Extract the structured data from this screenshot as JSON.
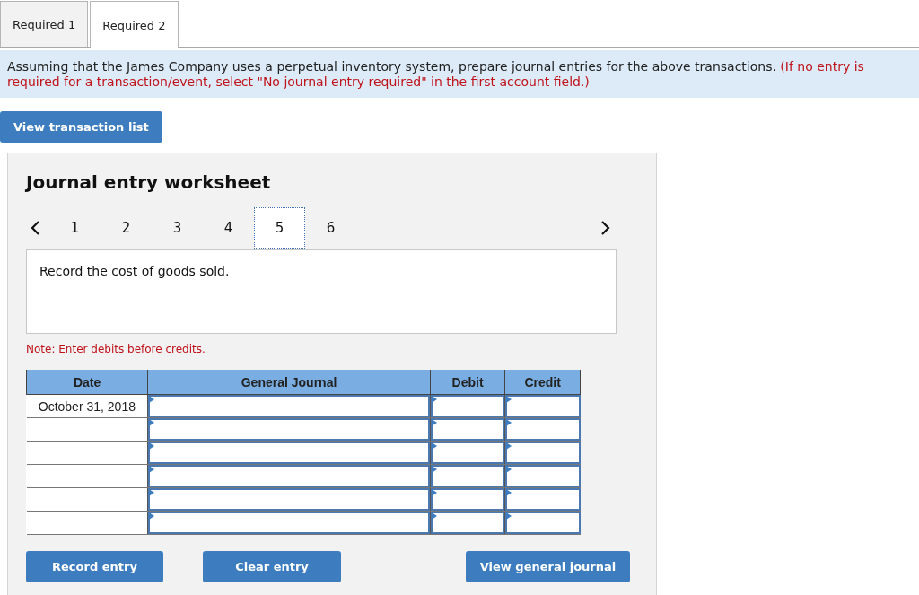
{
  "tabs": [
    {
      "label": "Required 1",
      "selected": false
    },
    {
      "label": "Required 2",
      "selected": true
    }
  ],
  "instructions": {
    "text": "Assuming that the James Company uses a perpetual inventory system, prepare journal entries for the above transactions.",
    "hint": "(If no entry is required for a transaction/event, select \"No journal entry required\" in the first account field.)"
  },
  "view_transaction_list": "View transaction list",
  "worksheet": {
    "title": "Journal entry worksheet",
    "pages": [
      {
        "label": "1",
        "selected": false
      },
      {
        "label": "2",
        "selected": false
      },
      {
        "label": "3",
        "selected": false
      },
      {
        "label": "4",
        "selected": false
      },
      {
        "label": "5",
        "selected": true
      },
      {
        "label": "6",
        "selected": false
      }
    ],
    "description": "Record the cost of goods sold.",
    "note": "Note: Enter debits before credits.",
    "table": {
      "columns": [
        "Date",
        "General Journal",
        "Debit",
        "Credit"
      ],
      "rows": [
        {
          "date": "October 31, 2018"
        },
        {},
        {},
        {},
        {},
        {}
      ]
    },
    "buttons": [
      "Record entry",
      "Clear entry",
      "View general journal"
    ]
  }
}
